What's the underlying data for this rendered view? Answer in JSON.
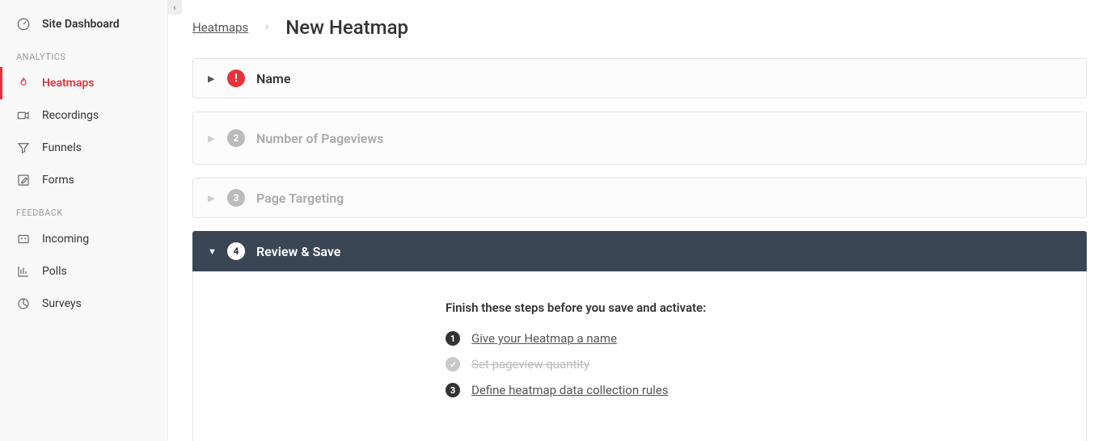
{
  "sidebar": {
    "dashboard": "Site Dashboard",
    "sections": {
      "analytics": "ANALYTICS",
      "feedback": "FEEDBACK"
    },
    "items": {
      "heatmaps": "Heatmaps",
      "recordings": "Recordings",
      "funnels": "Funnels",
      "forms": "Forms",
      "incoming": "Incoming",
      "polls": "Polls",
      "surveys": "Surveys"
    }
  },
  "breadcrumb": {
    "root": "Heatmaps",
    "current": "New Heatmap"
  },
  "steps": {
    "name": {
      "title": "Name"
    },
    "pageviews": {
      "num": "2",
      "title": "Number of Pageviews"
    },
    "targeting": {
      "num": "3",
      "title": "Page Targeting"
    },
    "review": {
      "num": "4",
      "title": "Review & Save"
    }
  },
  "review": {
    "heading": "Finish these steps before you save and activate:",
    "items": {
      "name": {
        "num": "1",
        "label": "Give your Heatmap a name"
      },
      "pageviews": {
        "label": "Set pageview quantity"
      },
      "rules": {
        "num": "3",
        "label": "Define heatmap data collection rules"
      }
    }
  }
}
